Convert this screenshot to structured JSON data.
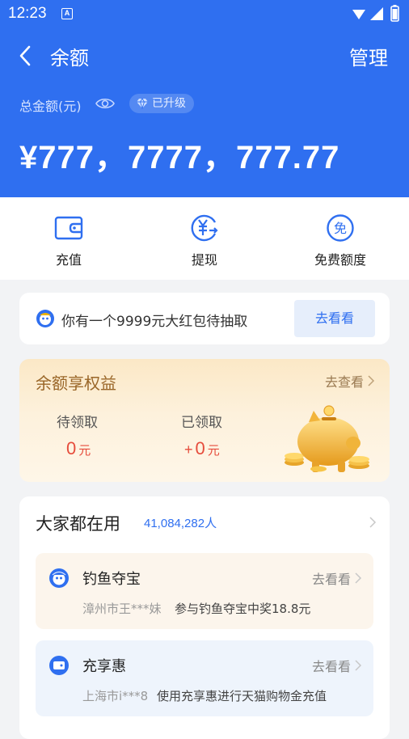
{
  "status_bar": {
    "time": "12:23",
    "notification_icon": "A"
  },
  "nav": {
    "title": "余额",
    "manage_label": "管理"
  },
  "balance": {
    "label": "总金额(元)",
    "badge": "已升级",
    "amount": "¥777，7777，777.77"
  },
  "actions": [
    {
      "label": "充值",
      "icon": "wallet-icon"
    },
    {
      "label": "提现",
      "icon": "withdraw-icon"
    },
    {
      "label": "免费额度",
      "icon": "free-quota-icon"
    }
  ],
  "promo": {
    "text": "你有一个9999元大红包待抽取",
    "button": "去看看"
  },
  "benefits": {
    "title": "余额享权益",
    "link": "去查看",
    "pending_label": "待领取",
    "pending_value": "0",
    "pending_unit": "元",
    "claimed_label": "已领取",
    "claimed_prefix": "+",
    "claimed_value": "0",
    "claimed_unit": "元"
  },
  "popular": {
    "title": "大家都在用",
    "count": "41,084,282人",
    "items": [
      {
        "name": "钓鱼夺宝",
        "link": "去看看",
        "user": "漳州市王***妹",
        "desc": "参与钓鱼夺宝中奖18.8元"
      },
      {
        "name": "充享惠",
        "link": "去看看",
        "user": "上海市i***8",
        "desc": "使用充享惠进行天猫购物金充值"
      }
    ]
  },
  "colors": {
    "primary": "#2f6ff0",
    "red": "#e64c3c",
    "gold": "#9a6628"
  }
}
